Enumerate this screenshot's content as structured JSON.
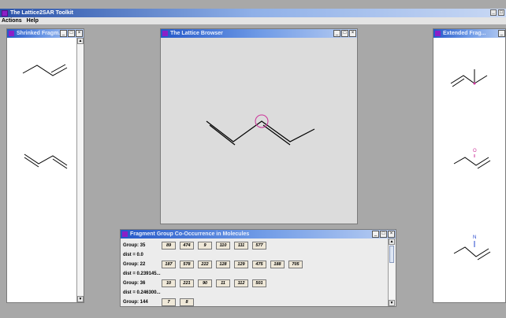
{
  "app": {
    "title": "The Lattice2SAR Toolkit"
  },
  "menu": {
    "items": [
      "Actions",
      "Help"
    ]
  },
  "left_window": {
    "title": "Shrinked Fragm..."
  },
  "browser_window": {
    "title": "The Lattice Browser"
  },
  "right_window": {
    "title": "Extended Frag...",
    "atoms": [
      "O",
      "N"
    ]
  },
  "cooccurrence_window": {
    "title": "Fragment Group Co-Occurrence in Molecules",
    "rows": [
      {
        "label": "Group: 35",
        "values": [
          "89",
          "474",
          "9",
          "110",
          "111",
          "577"
        ]
      },
      {
        "label": "dist = 0.0",
        "values": []
      },
      {
        "label": "Group: 22",
        "values": [
          "187",
          "578",
          "222",
          "128",
          "129",
          "475",
          "188",
          "705"
        ]
      },
      {
        "label": "dist = 0.239145...",
        "values": []
      },
      {
        "label": "Group: 36",
        "values": [
          "10",
          "221",
          "90",
          "11",
          "112",
          "501"
        ]
      },
      {
        "label": "dist = 0.246300...",
        "values": []
      },
      {
        "label": "Group: 144",
        "values": [
          "7",
          "8"
        ]
      }
    ]
  },
  "window_buttons": {
    "minimize": "_",
    "maximize": "□",
    "close": "×"
  },
  "scroll": {
    "up": "▲",
    "down": "▼"
  },
  "colors": {
    "highlight": "#cc3399",
    "title_purple": "#8b1fc7"
  }
}
